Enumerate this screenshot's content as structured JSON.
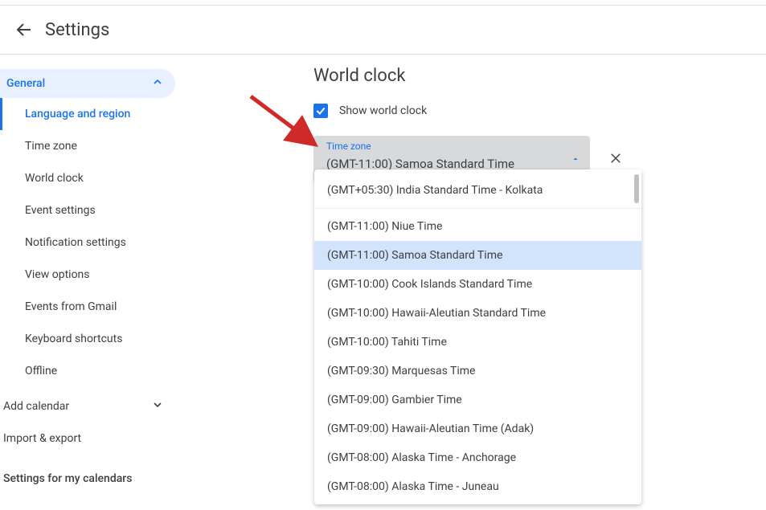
{
  "header": {
    "title": "Settings"
  },
  "sidebar": {
    "general": {
      "label": "General",
      "items": [
        "Language and region",
        "Time zone",
        "World clock",
        "Event settings",
        "Notification settings",
        "View options",
        "Events from Gmail",
        "Keyboard shortcuts",
        "Offline"
      ]
    },
    "add_calendar": "Add calendar",
    "import_export": "Import & export",
    "footer": "Settings for my calendars"
  },
  "worldclock": {
    "title": "World clock",
    "checkbox_label": "Show world clock",
    "checked": true,
    "tz_field_label": "Time zone",
    "tz_selected": "(GMT-11:00) Samoa Standard Time",
    "dropdown": {
      "recent": [
        "(GMT+05:30) India Standard Time - Kolkata"
      ],
      "options": [
        "(GMT-11:00) Niue Time",
        "(GMT-11:00) Samoa Standard Time",
        "(GMT-10:00) Cook Islands Standard Time",
        "(GMT-10:00) Hawaii-Aleutian Standard Time",
        "(GMT-10:00) Tahiti Time",
        "(GMT-09:30) Marquesas Time",
        "(GMT-09:00) Gambier Time",
        "(GMT-09:00) Hawaii-Aleutian Time (Adak)",
        "(GMT-08:00) Alaska Time - Anchorage",
        "(GMT-08:00) Alaska Time - Juneau"
      ],
      "highlighted_index": 1
    }
  },
  "colors": {
    "accent": "#1a73e8",
    "annotation_arrow": "#cf2a27"
  }
}
